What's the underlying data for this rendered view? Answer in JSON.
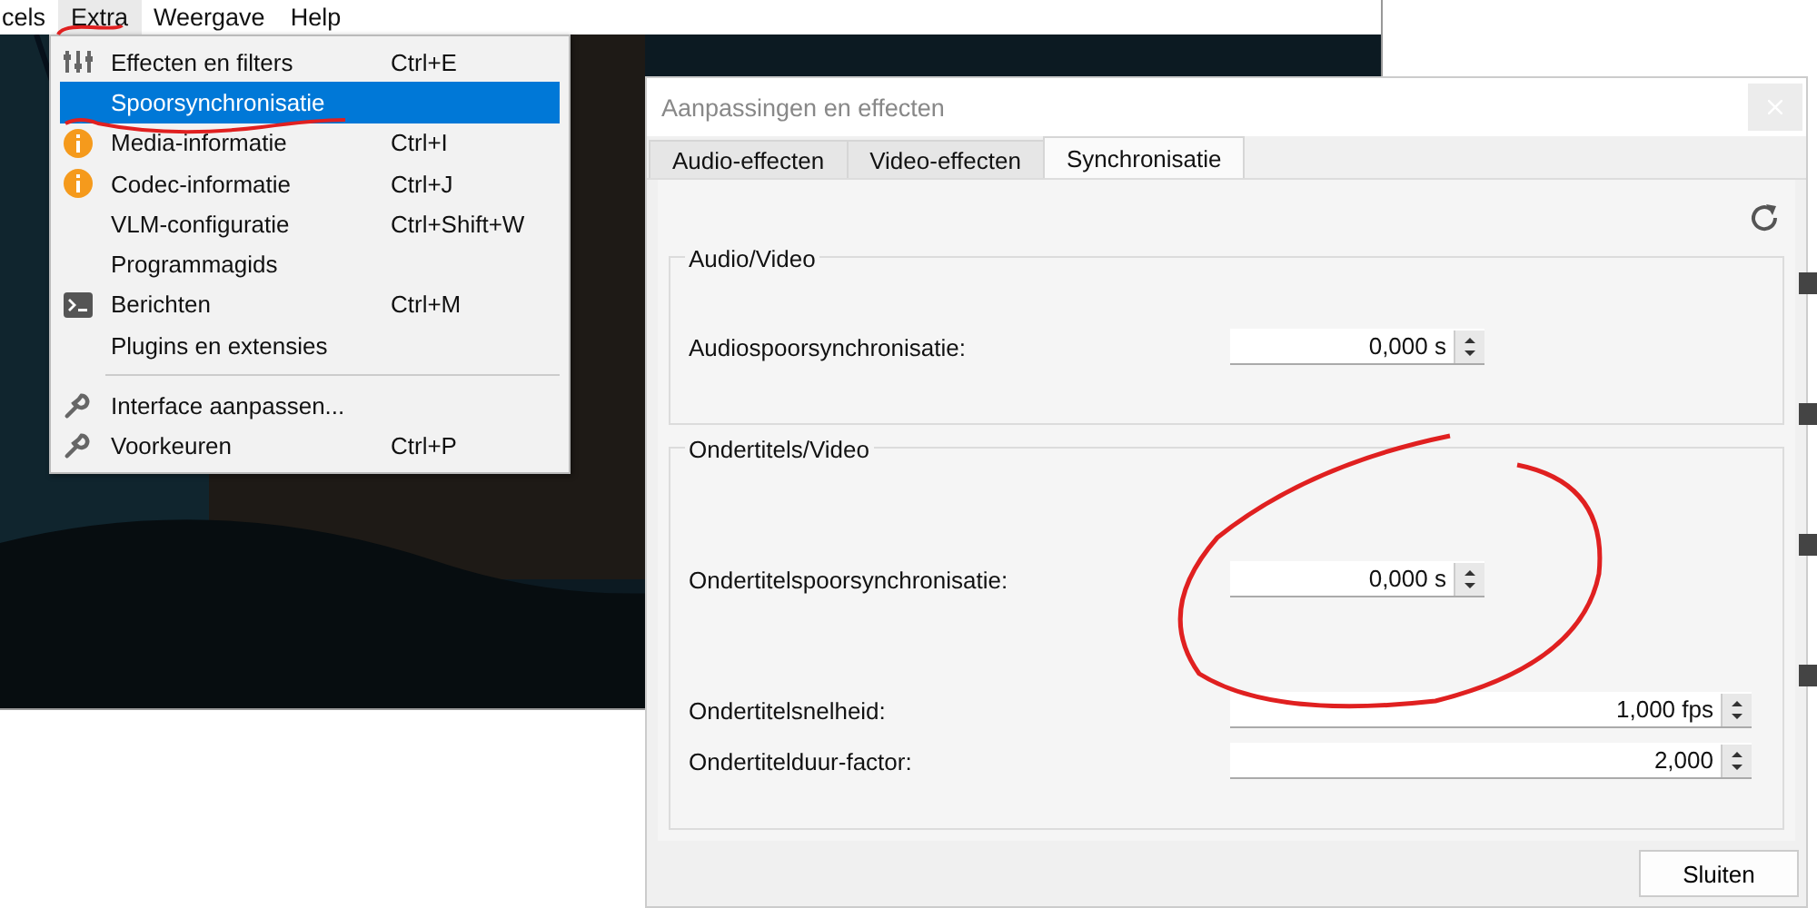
{
  "menubar": [
    {
      "label": "cels",
      "selected": false
    },
    {
      "label": "Extra",
      "selected": true
    },
    {
      "label": "Weergave",
      "selected": false
    },
    {
      "label": "Help",
      "selected": false
    }
  ],
  "menu": [
    {
      "kind": "item",
      "label": "Effecten en filters",
      "shortcut": "Ctrl+E",
      "selected": false
    },
    {
      "kind": "item",
      "label": "Spoorsynchronisatie",
      "selected": true
    },
    {
      "kind": "item",
      "label": "Media-informatie",
      "shortcut": "Ctrl+I",
      "selected": false
    },
    {
      "kind": "item",
      "label": "Codec-informatie",
      "shortcut": "Ctrl+J",
      "selected": false
    },
    {
      "kind": "item",
      "label": "VLM-configuratie",
      "shortcut": "Ctrl+Shift+W",
      "selected": false
    },
    {
      "kind": "item",
      "label": "Programmagids",
      "selected": false
    },
    {
      "kind": "item",
      "label": "Berichten",
      "shortcut": "Ctrl+M",
      "selected": false
    },
    {
      "kind": "item",
      "label": "Plugins en extensies",
      "selected": false
    },
    {
      "kind": "separator"
    },
    {
      "kind": "item",
      "label": "Interface aanpassen...",
      "selected": false
    },
    {
      "kind": "item",
      "label": "Voorkeuren",
      "shortcut": "Ctrl+P",
      "selected": false
    }
  ],
  "dialog": {
    "title": "Aanpassingen en effecten",
    "tabs": [
      {
        "label": "Audio-effecten",
        "selected": false
      },
      {
        "label": "Video-effecten",
        "selected": false
      },
      {
        "label": "Synchronisatie",
        "selected": true
      }
    ],
    "groups": [
      {
        "title": "Audio/Video",
        "rows": [
          {
            "label": "Audiospoorsynchronisatie:",
            "value": "0,000 s"
          }
        ]
      },
      {
        "title": "Ondertitels/Video",
        "rows": [
          {
            "label": "Ondertitelspoorsynchronisatie:",
            "value": "0,000 s"
          },
          {
            "label": "Ondertitelsnelheid:",
            "value": "1,000 fps"
          },
          {
            "label": "Ondertitelduur-factor:",
            "value": "2,000"
          }
        ]
      }
    ],
    "buttons": [
      "Sluiten"
    ]
  }
}
